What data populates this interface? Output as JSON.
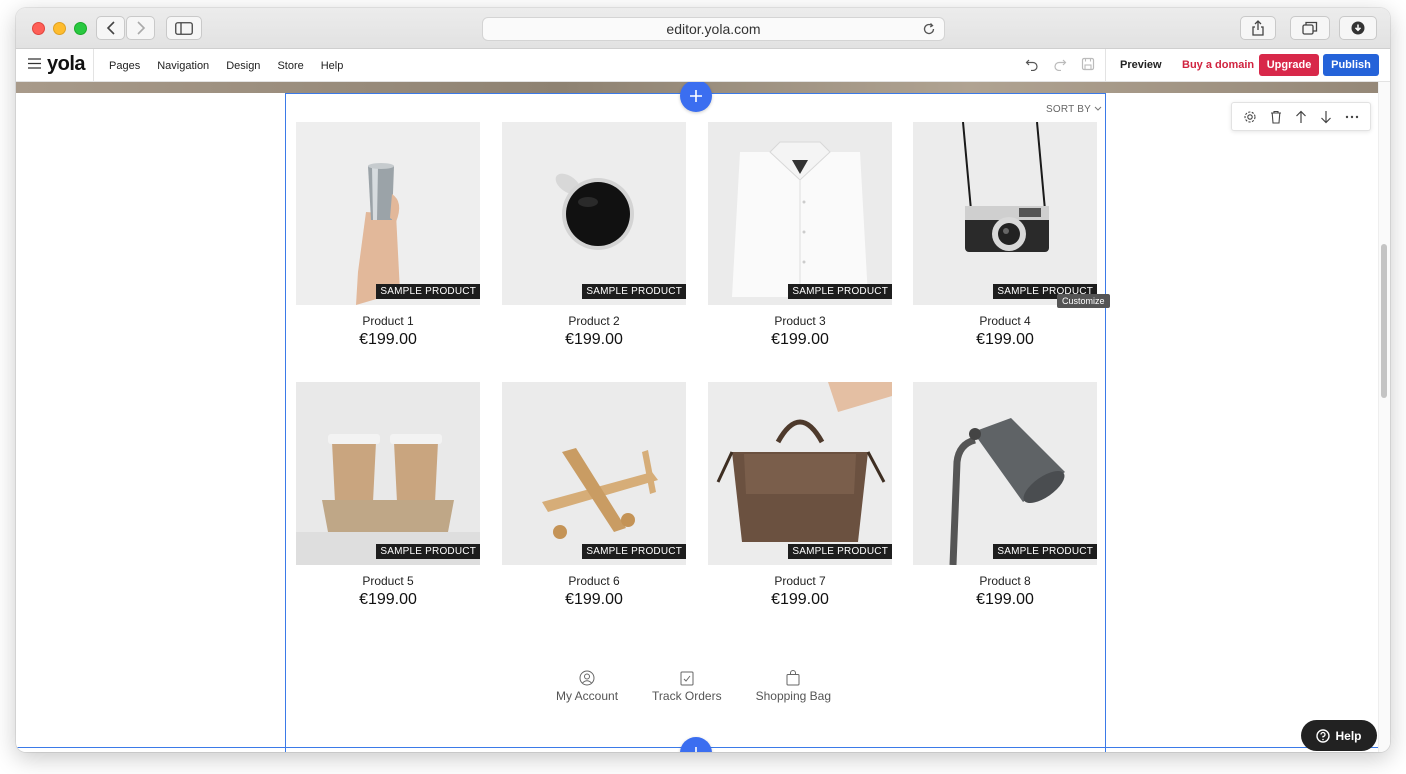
{
  "browser": {
    "url": "editor.yola.com"
  },
  "editor": {
    "logo": "yola",
    "menu": [
      "Pages",
      "Navigation",
      "Design",
      "Store",
      "Help"
    ],
    "preview_label": "Preview",
    "buy_domain_label": "Buy a domain",
    "upgrade_label": "Upgrade",
    "publish_label": "Publish"
  },
  "store": {
    "sort_label": "SORT BY",
    "customize_tooltip": "Customize",
    "badge_label": "SAMPLE PRODUCT",
    "products": [
      {
        "name": "Product 1",
        "price": "€199.00",
        "image": "steel-cup-in-hand"
      },
      {
        "name": "Product 2",
        "price": "€199.00",
        "image": "coffee-mug"
      },
      {
        "name": "Product 3",
        "price": "€199.00",
        "image": "folded-white-shirt"
      },
      {
        "name": "Product 4",
        "price": "€199.00",
        "image": "film-camera"
      },
      {
        "name": "Product 5",
        "price": "€199.00",
        "image": "coffee-cups-tray"
      },
      {
        "name": "Product 6",
        "price": "€199.00",
        "image": "wooden-plane"
      },
      {
        "name": "Product 7",
        "price": "€199.00",
        "image": "leather-bag"
      },
      {
        "name": "Product 8",
        "price": "€199.00",
        "image": "desk-lamp"
      }
    ],
    "links": {
      "account": "My Account",
      "orders": "Track Orders",
      "bag": "Shopping Bag"
    }
  },
  "help_label": "Help",
  "colors": {
    "accent_blue": "#3b6ef0",
    "upgrade_red": "#d8284a",
    "publish_blue": "#2563d9",
    "frame_blue": "#3b7ae8"
  }
}
